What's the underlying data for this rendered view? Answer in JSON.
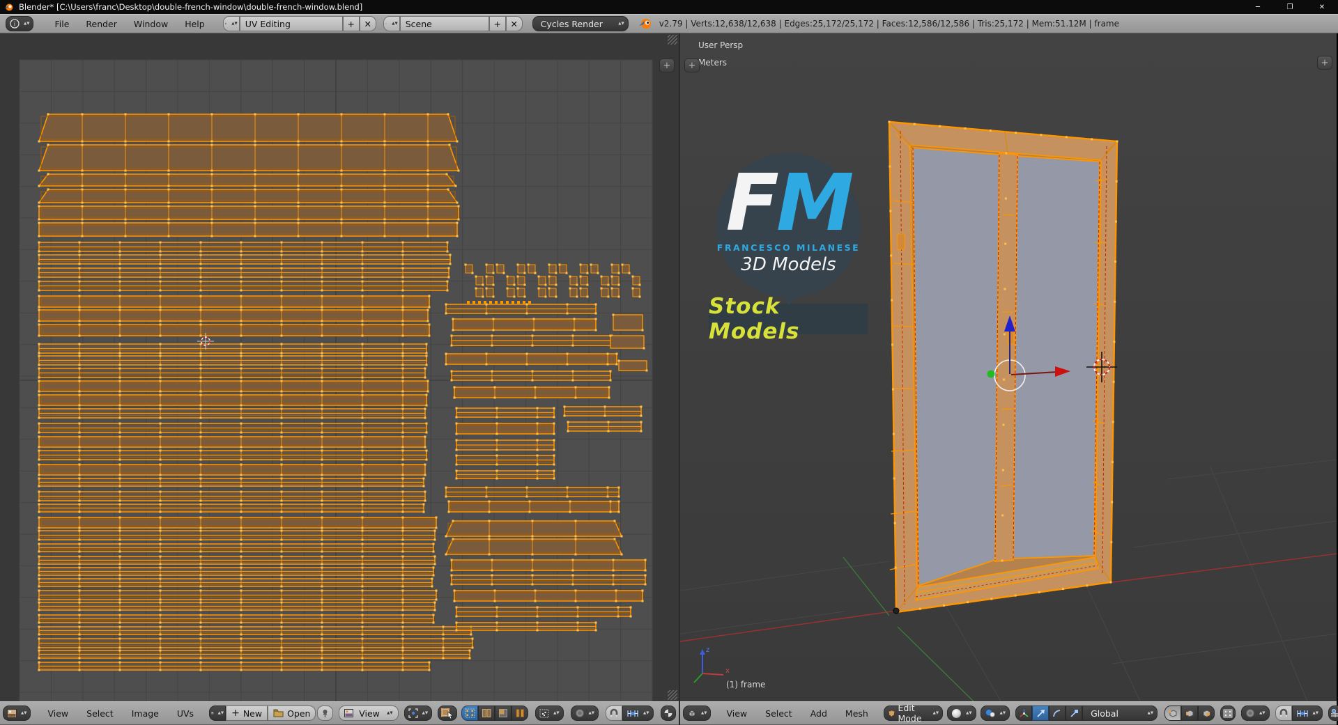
{
  "titlebar": {
    "title": "Blender* [C:\\Users\\franc\\Desktop\\double-french-window\\double-french-window.blend]",
    "minimize": "─",
    "maximize": "❐",
    "close": "✕"
  },
  "topbar": {
    "menus": {
      "file": "File",
      "render": "Render",
      "window": "Window",
      "help": "Help"
    },
    "layout": {
      "value": "UV Editing",
      "add": "+",
      "remove": "✕"
    },
    "scene": {
      "value": "Scene",
      "add": "+",
      "remove": "✕"
    },
    "engine": {
      "value": "Cycles Render"
    },
    "stats": "v2.79 | Verts:12,638/12,638 | Edges:25,172/25,172 | Faces:12,586/12,586 | Tris:25,172 | Mem:51.12M | frame"
  },
  "uv_editor": {
    "menus": {
      "view": "View",
      "select": "Select",
      "image": "Image",
      "uvs": "UVs"
    },
    "new_button": "New",
    "open_button": "Open",
    "mode": {
      "value": "View"
    }
  },
  "viewport": {
    "overlay": {
      "view_name": "User Persp",
      "unit": "Meters",
      "object_info": "(1) frame"
    },
    "axis_labels": {
      "x": "x",
      "z": "z"
    },
    "menus": {
      "view": "View",
      "select": "Select",
      "add": "Add",
      "mesh": "Mesh"
    },
    "mode": {
      "value": "Edit Mode"
    },
    "orientation": {
      "value": "Global"
    }
  },
  "logo": {
    "initial_f": "F",
    "initial_m": "M",
    "name": "FRANCESCO MILANESE",
    "tagline": "3D Models",
    "banner": "Stock Models",
    "colors": {
      "blue": "#2fa9e1",
      "yellow": "#d7e139",
      "circle_bg": "#37434c",
      "banner_bg": "#313d45",
      "white": "#f4f4f4"
    }
  },
  "theme": {
    "selection_orange": "#ff9600",
    "vertex_dot": "#ffc04d",
    "face_brown": "#7a5b3c",
    "glass_grey": "#9598a6",
    "frame_tan": "#c4915f"
  }
}
